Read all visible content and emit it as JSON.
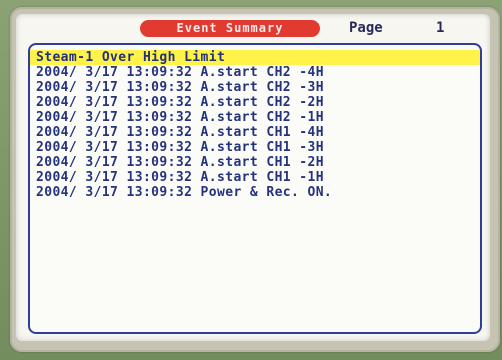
{
  "screen": {
    "title": "Event Summary",
    "page_label": "Page",
    "page_number": "1"
  },
  "events": [
    {
      "text": "Steam-1 Over High Limit"
    },
    {
      "text": "2004/ 3/17 13:09:32 A.start CH2 -4H"
    },
    {
      "text": "2004/ 3/17 13:09:32 A.start CH2 -3H"
    },
    {
      "text": "2004/ 3/17 13:09:32 A.start CH2 -2H"
    },
    {
      "text": "2004/ 3/17 13:09:32 A.start CH2 -1H"
    },
    {
      "text": "2004/ 3/17 13:09:32 A.start CH1 -4H"
    },
    {
      "text": "2004/ 3/17 13:09:32 A.start CH1 -3H"
    },
    {
      "text": "2004/ 3/17 13:09:32 A.start CH1 -2H"
    },
    {
      "text": "2004/ 3/17 13:09:32 A.start CH1 -1H"
    },
    {
      "text": "2004/ 3/17 13:09:32 Power & Rec. ON."
    }
  ],
  "colors": {
    "title_bg": "#e13a31",
    "highlight_bg": "#fff34a",
    "text": "#25327c",
    "panel_border": "#2f3e9a",
    "bezel": "#c6c3b2",
    "outer": "#7f9969"
  }
}
